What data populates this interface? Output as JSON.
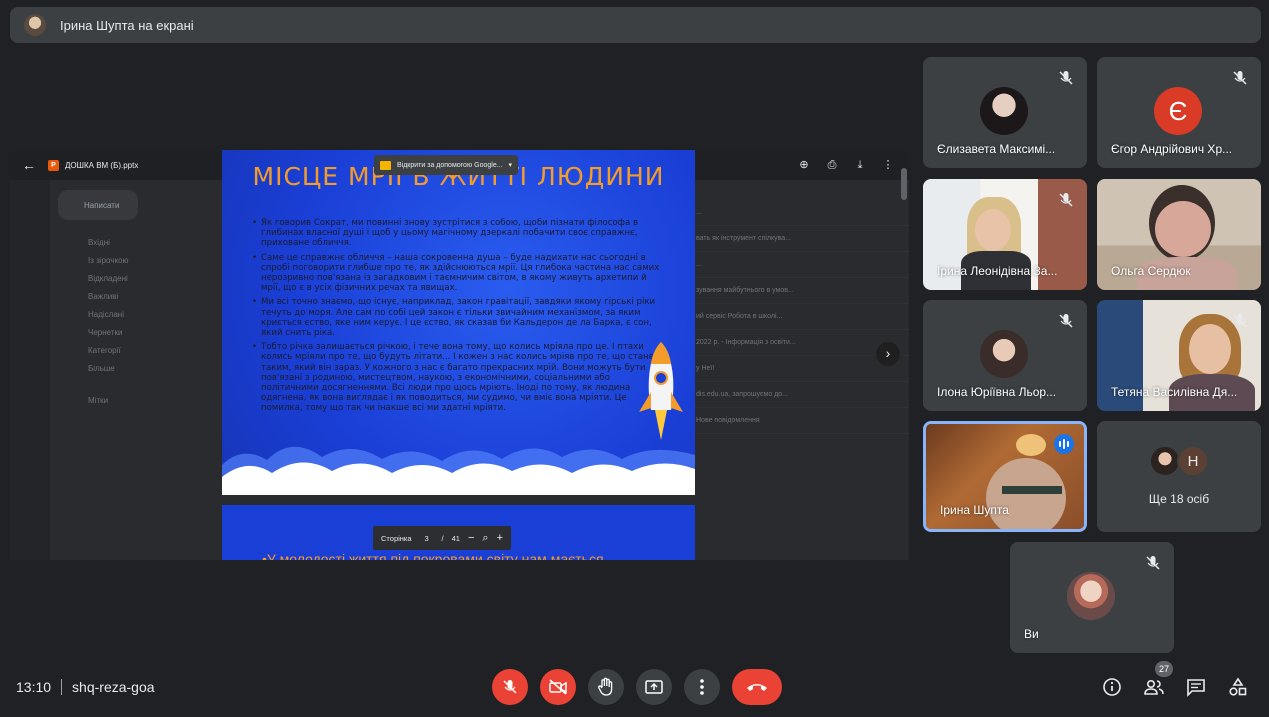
{
  "presenter_banner": {
    "text": "Ірина Шупта на екрані"
  },
  "shared_screen": {
    "file_name": "ДОШКА ВМ (Б).pptx",
    "open_with_label": "Відкрити за допомогою Google...",
    "slide_title": "МІСЦЕ МРІЇ В ЖИТТІ ЛЮДИНИ",
    "bullets": [
      "Як говорив Сократ, ми повинні знову зустрітися з собою, щоби пізнати філософа в глибинах власної душі і щоб у цьому магічному дзеркалі побачити своє справжнє, приховане обличчя.",
      "Саме це справжнє обличчя – наша сокровенна душа – буде надихати нас сьогодні в спробі поговорити глибше про те, як здійснюються мрії. Ця глибока частина нас самих нерозривно пов'язана із загадковим і таємничим світом, в якому живуть архетипи й мрії, що є в усіх фізичних речах та явищах.",
      "Ми всі точно знаємо, що існує, наприклад, закон гравітації, завдяки якому гірські ріки течуть до моря. Але сам по собі цей закон є тільки звичайним механізмом, за яким криється єство, яке ним керує. І це єство, як сказав би Кальдерон де ла Барка, є сон, який снить ріка.",
      "Тобто річка залишається річкою, і тече вона тому, що колись мріяла про це. І птахи колись мріяли про те, що будуть літати... І кожен з нас колись мріяв про те, що стане таким, який він зараз. У кожного з нас є багато прекрасних мрій. Вони можуть бути пов'язані з родиною, мистецтвом, наукою, з економічними, соціальними або політичними досягненнями. Всі люди про щось мріють. Іноді по тому, як людина одягнена, як вона виглядає і як поводиться, ми судимо, чи вміє вона мріяти. Це помилка, тому що так чи інакше всі ми здатні мріяти."
    ],
    "next_slide_text": "•У молодості життя під покровами світу нам мається",
    "pager": {
      "label": "Сторінка",
      "current": "3",
      "separator": "/",
      "total": "41"
    },
    "gmail": {
      "compose": "Написати",
      "nav": [
        "Вхідні",
        "Із зірочкою",
        "Відкладені",
        "Важливі",
        "Надіслані",
        "Чернетки",
        "Категорії",
        "Більше"
      ],
      "labels_title": "Мітки",
      "mail_rows": [
        "...",
        "вать як інструмент спілкува...",
        "...",
        "зування майбутнього в умов...",
        "ий сервіс Робота в школі...",
        "2022 р. - Інформація з освіти...",
        "у Неї!",
        "dis.edu.ua, запрошуємо до...",
        "Нове повідомлення"
      ]
    }
  },
  "participants": [
    {
      "name": "Єлизавета Максимі...",
      "muted": true,
      "type": "photo",
      "color": "#2b2426"
    },
    {
      "name": "Єгор Андрійович Хр...",
      "muted": true,
      "type": "initial",
      "initial": "Є",
      "color": "#d93b26"
    },
    {
      "name": "Ірина Леонідівна За...",
      "muted": true,
      "type": "video"
    },
    {
      "name": "Ольга Сердюк",
      "muted": false,
      "type": "video"
    },
    {
      "name": "Ілона Юріївна Льор...",
      "muted": true,
      "type": "photo",
      "color": "#3a2c28"
    },
    {
      "name": "Тетяна Василівна Дя...",
      "muted": true,
      "type": "video"
    },
    {
      "name": "Ірина Шупта",
      "muted": false,
      "speaking": true,
      "type": "video"
    },
    {
      "name": "Ви",
      "muted": true,
      "type": "photo",
      "color": "#5a3a3a"
    }
  ],
  "more_participants": {
    "label": "Ще 18 осіб",
    "initial": "Н"
  },
  "meeting": {
    "time": "13:10",
    "code": "shq-reza-goa"
  },
  "people_count": "27",
  "colors": {
    "background": "#202124",
    "tile": "#3c4043",
    "danger": "#ea4335",
    "accent": "#8ab4f8"
  }
}
